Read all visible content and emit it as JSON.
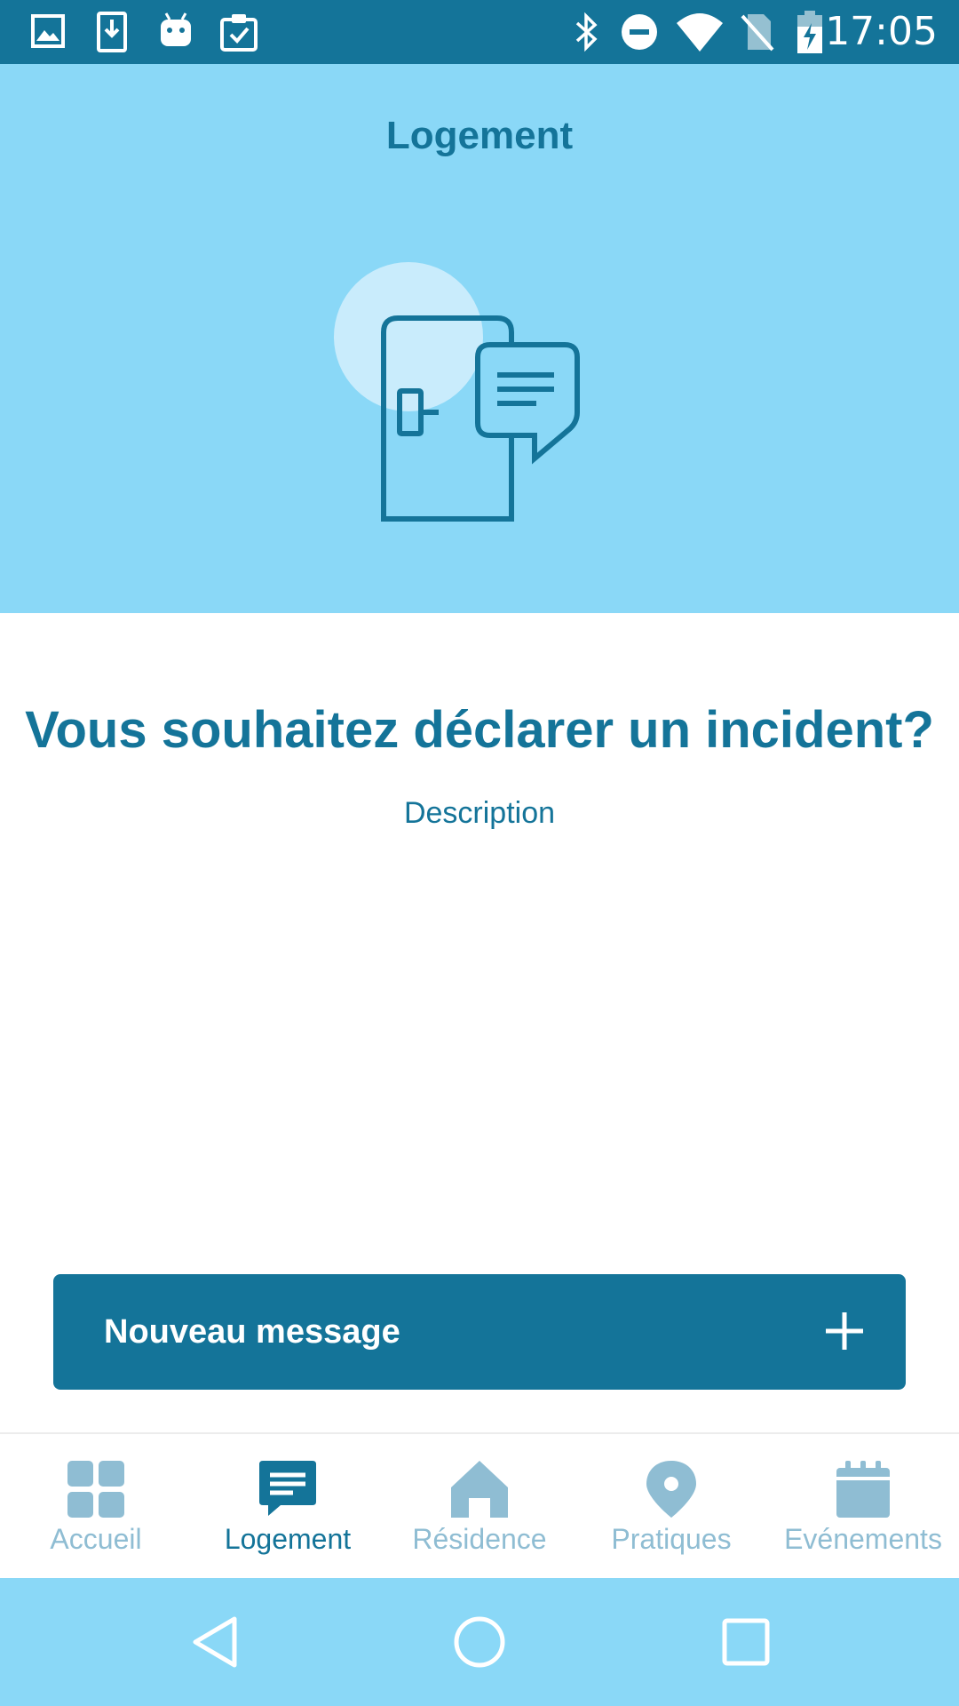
{
  "status_bar": {
    "time": "17:05",
    "left_icons": [
      "image-icon",
      "download-icon",
      "android-icon",
      "clipboard-check-icon"
    ],
    "right_icons": [
      "bluetooth-icon",
      "do-not-disturb-icon",
      "wifi-icon",
      "no-sim-icon",
      "battery-charging-icon"
    ]
  },
  "header": {
    "title": "Logement",
    "illustration": "door-message-icon"
  },
  "main": {
    "heading": "Vous souhaitez déclarer un incident?",
    "subheading": "Description"
  },
  "action_button": {
    "label": "Nouveau message",
    "icon": "plus-icon"
  },
  "bottom_nav": {
    "items": [
      {
        "label": "Accueil",
        "icon": "grid-icon",
        "active": false
      },
      {
        "label": "Logement",
        "icon": "message-icon",
        "active": true
      },
      {
        "label": "Résidence",
        "icon": "home-icon",
        "active": false
      },
      {
        "label": "Pratiques",
        "icon": "location-pin-icon",
        "active": false
      },
      {
        "label": "Evénements",
        "icon": "calendar-icon",
        "active": false
      }
    ]
  },
  "system_nav": {
    "buttons": [
      "back-icon",
      "home-circle-icon",
      "recents-icon"
    ]
  },
  "colors": {
    "primary": "#147499",
    "header_background": "#8ad8f7",
    "nav_inactive": "#8fbdd3"
  }
}
